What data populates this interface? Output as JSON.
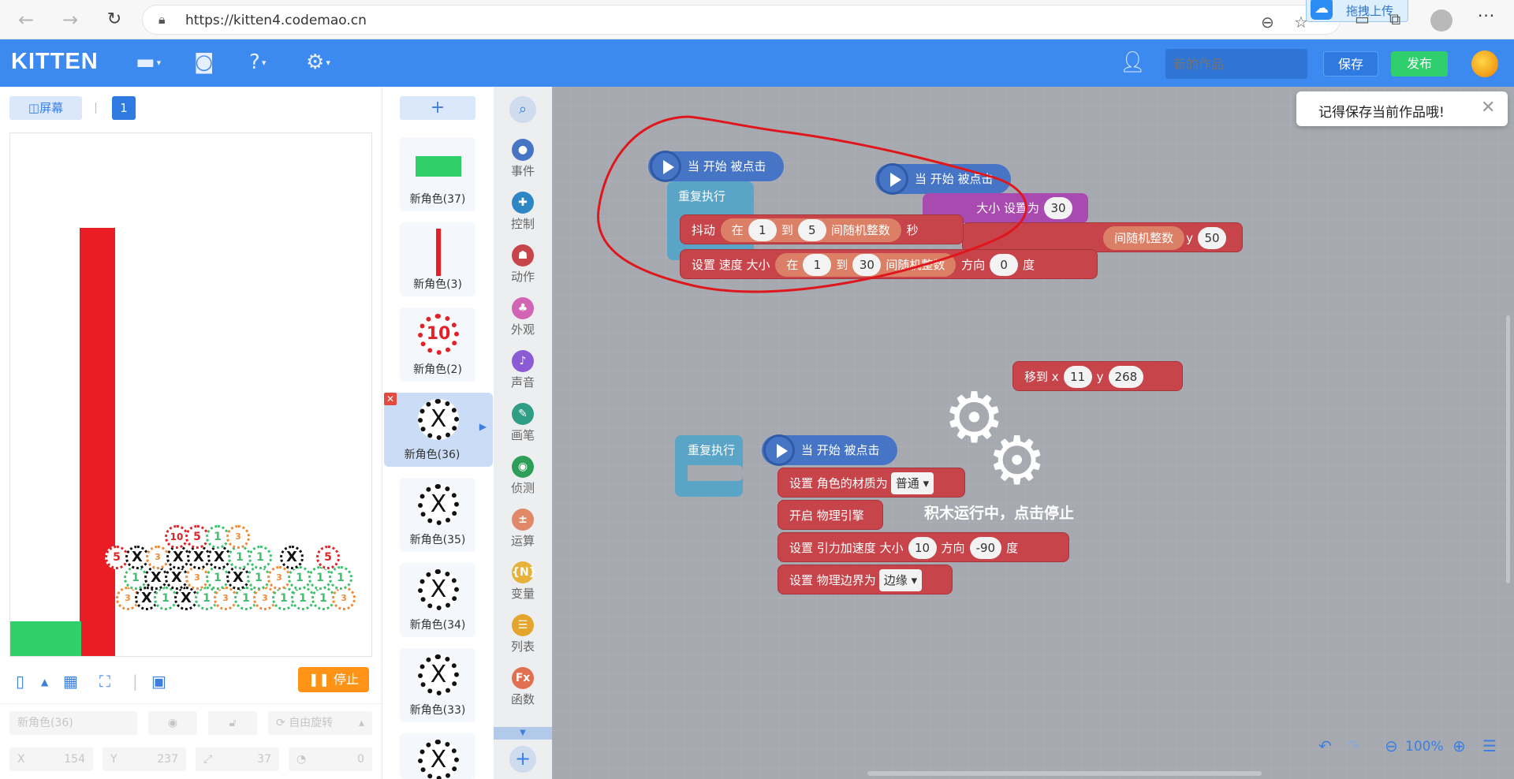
{
  "browser": {
    "url": "https://kitten4.codemao.cn",
    "upload_label": "拖拽上传"
  },
  "header": {
    "logo": "KITTEN",
    "project_title_placeholder": "新的作品",
    "save_label": "保存",
    "publish_label": "发布"
  },
  "stage": {
    "screen_label": "屏幕",
    "scene_number": "1",
    "stop_label": "停止",
    "props": {
      "sprite_name": "新角色(36)",
      "rotate_label": "自由旋转",
      "x_label": "X",
      "x_value": "154",
      "y_label": "Y",
      "y_value": "237",
      "size_value": "37",
      "direction_value": "0"
    }
  },
  "sprites": {
    "add_label": "+",
    "items": [
      {
        "name": "新角色(37)"
      },
      {
        "name": "新角色(3)"
      },
      {
        "name": "新角色(2)",
        "text": "10"
      },
      {
        "name": "新角色(36)",
        "text": "X"
      },
      {
        "name": "新角色(35)",
        "text": "X"
      },
      {
        "name": "新角色(34)",
        "text": "X"
      },
      {
        "name": "新角色(33)",
        "text": "X"
      },
      {
        "name": "",
        "text": "X"
      }
    ]
  },
  "categories": [
    {
      "name": "事件",
      "color": "#4775c6",
      "icon": "●"
    },
    {
      "name": "控制",
      "color": "#2f86c5",
      "icon": "✚"
    },
    {
      "name": "动作",
      "color": "#c7454a",
      "icon": "☗"
    },
    {
      "name": "外观",
      "color": "#d264b4",
      "icon": "♣"
    },
    {
      "name": "声音",
      "color": "#8b5bd6",
      "icon": "♪"
    },
    {
      "name": "画笔",
      "color": "#2f9e85",
      "icon": "✎"
    },
    {
      "name": "侦测",
      "color": "#2f9e58",
      "icon": "◉"
    },
    {
      "name": "运算",
      "color": "#e08868",
      "icon": "±"
    },
    {
      "name": "变量",
      "color": "#e8b23a",
      "icon": "{N}"
    },
    {
      "name": "列表",
      "color": "#e3a52c",
      "icon": "☰"
    },
    {
      "name": "函数",
      "color": "#e07050",
      "icon": "Fx"
    }
  ],
  "blocks": {
    "when_start": "当 开始 被点击",
    "repeat_forever": "重复执行",
    "shake": "抖动",
    "in": "在",
    "to": "到",
    "random_int": "间随机整数",
    "seconds": "秒",
    "set_speed": "设置 速度 大小",
    "direction": "方向",
    "degree": "度",
    "set_size_to": "大小 设置为",
    "size_value": "30",
    "random_int_partial": "间随机整数",
    "y_label": "y",
    "y_value": "50",
    "move_to_x": "移到 x",
    "move_x": "11",
    "move_y": "268",
    "set_material": "设置 角色的材质为",
    "material_value": "普通",
    "enable_physics": "开启 物理引擎",
    "set_gravity": "设置 引力加速度 大小",
    "gravity_value": "10",
    "gravity_dir": "-90",
    "set_boundary": "设置 物理边界为",
    "boundary_value": "边缘",
    "shake_min": "1",
    "shake_max": "5",
    "speed_min": "1",
    "speed_max": "30",
    "speed_dir": "0"
  },
  "workspace": {
    "toast_text": "记得保存当前作品哦!",
    "running_text": "积木运行中，点击停止",
    "zoom_label": "100%"
  }
}
